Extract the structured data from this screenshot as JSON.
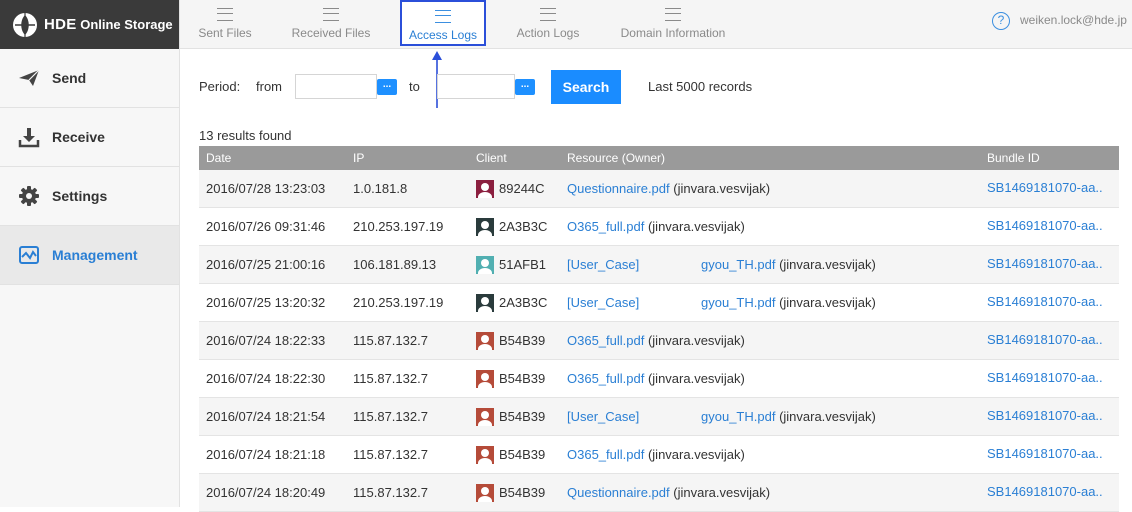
{
  "app": {
    "logo_brand": "HDE",
    "logo_product": "Online Storage"
  },
  "sidebar": {
    "items": [
      {
        "label": "Send",
        "icon": "paper-plane-icon"
      },
      {
        "label": "Receive",
        "icon": "download-icon"
      },
      {
        "label": "Settings",
        "icon": "gear-icon"
      },
      {
        "label": "Management",
        "icon": "chart-monitor-icon",
        "active": true
      }
    ]
  },
  "tabs": [
    {
      "label": "Sent Files"
    },
    {
      "label": "Received Files"
    },
    {
      "label": "Access Logs",
      "active": true
    },
    {
      "label": "Action Logs"
    },
    {
      "label": "Domain Information"
    }
  ],
  "user": {
    "email": "weiken.lock@hde.jp",
    "help": "?"
  },
  "filter": {
    "period_label": "Period:",
    "from_label": "from",
    "to_label": "to",
    "from_value": "",
    "to_value": "",
    "calendar_button": "...",
    "search_label": "Search",
    "records_note": "Last 5000 records"
  },
  "results": {
    "count_text": "13 results found",
    "columns": [
      "Date",
      "IP",
      "Client",
      "Resource (Owner)",
      "Bundle ID"
    ],
    "rows": [
      {
        "date": "2016/07/28 13:23:03",
        "ip": "1.0.181.8",
        "client": "89244C",
        "avatar_color": "#8b1f3f",
        "resource": "Questionnaire.pdf",
        "resource2": "",
        "owner": "(jinvara.vesvijak)",
        "bundle": "SB1469181070-aa.."
      },
      {
        "date": "2016/07/26 09:31:46",
        "ip": "210.253.197.19",
        "client": "2A3B3C",
        "avatar_color": "#2a3b3c",
        "resource": "O365_full.pdf",
        "resource2": "",
        "owner": "(jinvara.vesvijak)",
        "bundle": "SB1469181070-aa.."
      },
      {
        "date": "2016/07/25 21:00:16",
        "ip": "106.181.89.13",
        "client": "51AFB1",
        "avatar_color": "#51afb1",
        "resource": "[User_Case]",
        "resource2": "gyou_TH.pdf",
        "owner": "(jinvara.vesvijak)",
        "bundle": "SB1469181070-aa.."
      },
      {
        "date": "2016/07/25 13:20:32",
        "ip": "210.253.197.19",
        "client": "2A3B3C",
        "avatar_color": "#2a3b3c",
        "resource": "[User_Case]",
        "resource2": "gyou_TH.pdf",
        "owner": "(jinvara.vesvijak)",
        "bundle": "SB1469181070-aa.."
      },
      {
        "date": "2016/07/24 18:22:33",
        "ip": "115.87.132.7",
        "client": "B54B39",
        "avatar_color": "#b54b39",
        "resource": "O365_full.pdf",
        "resource2": "",
        "owner": "(jinvara.vesvijak)",
        "bundle": "SB1469181070-aa.."
      },
      {
        "date": "2016/07/24 18:22:30",
        "ip": "115.87.132.7",
        "client": "B54B39",
        "avatar_color": "#b54b39",
        "resource": "O365_full.pdf",
        "resource2": "",
        "owner": "(jinvara.vesvijak)",
        "bundle": "SB1469181070-aa.."
      },
      {
        "date": "2016/07/24 18:21:54",
        "ip": "115.87.132.7",
        "client": "B54B39",
        "avatar_color": "#b54b39",
        "resource": "[User_Case]",
        "resource2": "gyou_TH.pdf",
        "owner": "(jinvara.vesvijak)",
        "bundle": "SB1469181070-aa.."
      },
      {
        "date": "2016/07/24 18:21:18",
        "ip": "115.87.132.7",
        "client": "B54B39",
        "avatar_color": "#b54b39",
        "resource": "O365_full.pdf",
        "resource2": "",
        "owner": "(jinvara.vesvijak)",
        "bundle": "SB1469181070-aa.."
      },
      {
        "date": "2016/07/24 18:20:49",
        "ip": "115.87.132.7",
        "client": "B54B39",
        "avatar_color": "#b54b39",
        "resource": "Questionnaire.pdf",
        "resource2": "",
        "owner": "(jinvara.vesvijak)",
        "bundle": "SB1469181070-aa.."
      }
    ]
  },
  "colors": {
    "accent": "#1a8cff",
    "link": "#2a7fd4",
    "header_bg": "#9a9a9a",
    "logo_bg": "#3a3a3a",
    "annotation_arrow": "#2b4fd9"
  }
}
